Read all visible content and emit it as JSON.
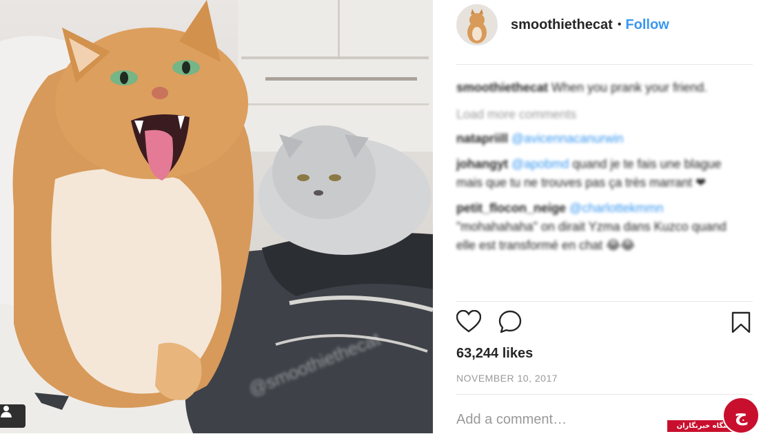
{
  "post": {
    "photo_alt": "smoothiethecat",
    "photo_watermark": "@smoothiethecat",
    "tag_icon": "person-tag-icon"
  },
  "header": {
    "username": "smoothiethecat",
    "separator": "•",
    "follow_label": "Follow"
  },
  "comments": {
    "caption": {
      "user": "smoothiethecat",
      "text": "When you prank your friend."
    },
    "load_more": "Load more comments",
    "items": [
      {
        "user": "natapriill",
        "mention": "@avicennacanurwin",
        "text": ""
      },
      {
        "user": "johangyt",
        "mention": "@apobmd",
        "text": "quand je te fais une blague mais que tu ne trouves pas ça très marrant ❤"
      },
      {
        "user": "petit_flocon_neige",
        "mention": "@charlottekmmn",
        "text": "\"mohahahaha\" on dirait Yzma dans Kuzco quand elle est transformé en chat 😂😂"
      }
    ]
  },
  "actions": {
    "like_icon": "heart-icon",
    "comment_icon": "comment-bubble-icon",
    "save_icon": "bookmark-icon"
  },
  "likes": "63,244 likes",
  "date": "NOVEMBER 10, 2017",
  "comment_input": {
    "placeholder": "Add a comment…",
    "value": ""
  },
  "watermark": {
    "text": "باشگاه خبرنگاران",
    "logo_letter": "ج"
  },
  "colors": {
    "accent": "#3897f0",
    "text": "#262626",
    "muted": "#999999",
    "watermark": "#c8102e"
  }
}
